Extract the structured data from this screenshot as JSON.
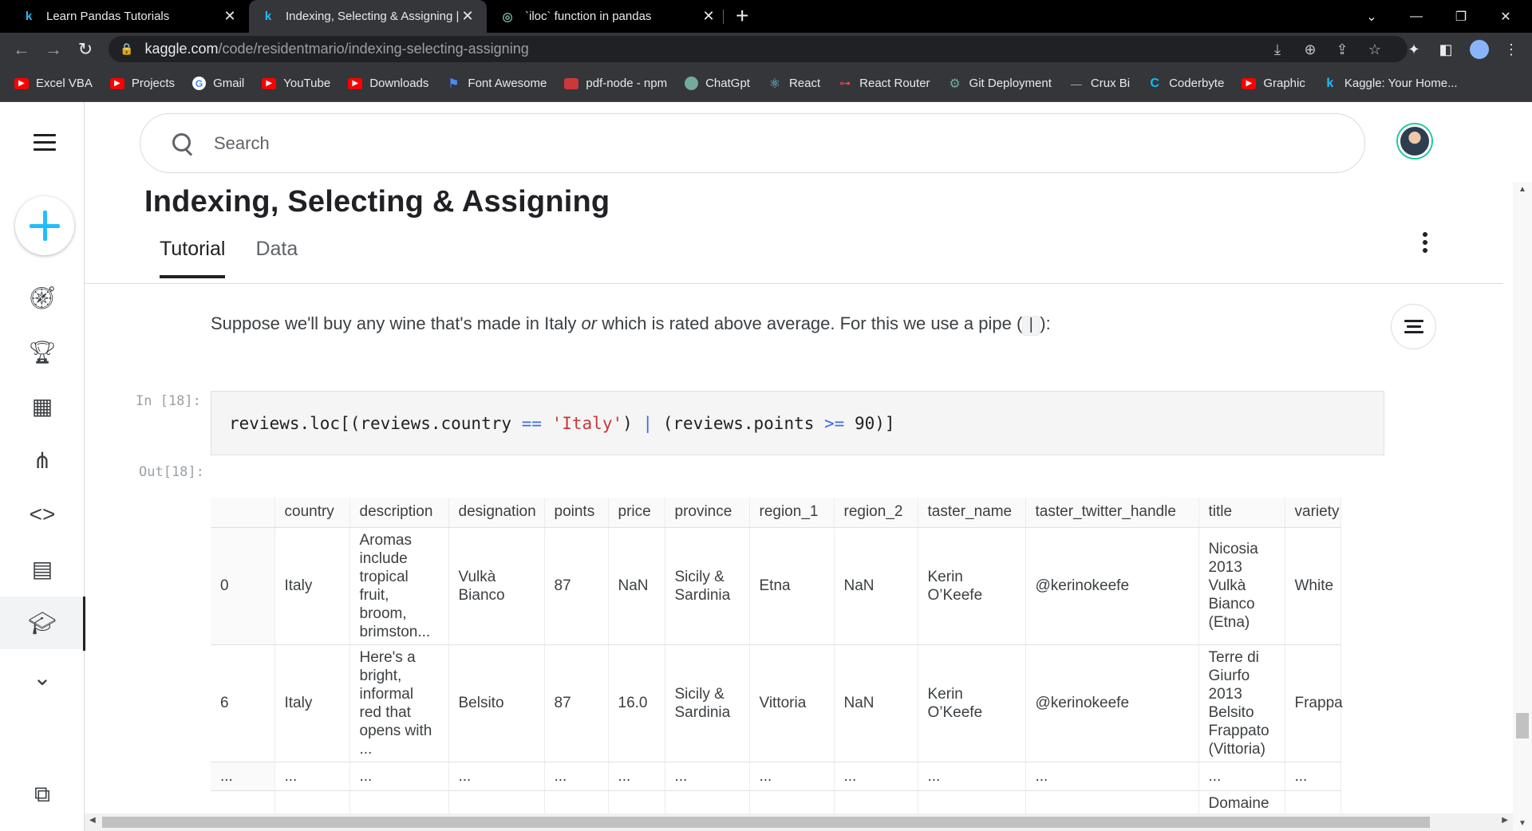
{
  "browser": {
    "tabs": [
      {
        "title": "Learn Pandas Tutorials",
        "favicon": "k"
      },
      {
        "title": "Indexing, Selecting & Assigning |",
        "favicon": "k"
      },
      {
        "title": "`iloc` function in pandas",
        "favicon": "chatgpt-logo"
      }
    ],
    "url_host": "kaggle.com",
    "url_path": "/code/residentmario/indexing-selecting-assigning",
    "bookmarks": [
      {
        "label": "Excel VBA",
        "icon": "youtube-icon"
      },
      {
        "label": "Projects",
        "icon": "youtube-icon"
      },
      {
        "label": "Gmail",
        "icon": "google-icon"
      },
      {
        "label": "YouTube",
        "icon": "youtube-icon"
      },
      {
        "label": "Downloads",
        "icon": "youtube-icon"
      },
      {
        "label": "Font Awesome",
        "icon": "flag-icon"
      },
      {
        "label": "pdf-node - npm",
        "icon": "npm-icon"
      },
      {
        "label": "ChatGpt",
        "icon": "chatgpt-icon"
      },
      {
        "label": "React",
        "icon": "react-icon"
      },
      {
        "label": "React Router",
        "icon": "react-router-icon"
      },
      {
        "label": "Git Deployment",
        "icon": "git-icon"
      },
      {
        "label": "Crux Bi",
        "icon": "crux-icon"
      },
      {
        "label": "Coderbyte",
        "icon": "coderbyte-icon"
      },
      {
        "label": "Graphic",
        "icon": "youtube-icon"
      },
      {
        "label": "Kaggle: Your Home...",
        "icon": "kaggle-icon"
      }
    ]
  },
  "search": {
    "placeholder": "Search"
  },
  "notebook": {
    "title": "Indexing, Selecting & Assigning",
    "tabs": [
      "Tutorial",
      "Data"
    ],
    "prose_before": "Suppose we'll buy any wine that's made in Italy ",
    "prose_em": "or",
    "prose_after": " which is rated above average. For this we use a pipe (",
    "prose_code": "|",
    "prose_end": "):",
    "in_prompt": "In [18]:",
    "out_prompt": "Out[18]:",
    "code": {
      "t1": "reviews.loc[(reviews.country ",
      "op1": "==",
      "t2": " ",
      "str1": "'Italy'",
      "t3": ") ",
      "op2": "|",
      "t4": " (reviews.points ",
      "op3": ">=",
      "t5": " ",
      "num1": "90",
      "t6": ")]"
    }
  },
  "table": {
    "columns": [
      "",
      "country",
      "description",
      "designation",
      "points",
      "price",
      "province",
      "region_1",
      "region_2",
      "taster_name",
      "taster_twitter_handle",
      "title",
      "variety"
    ],
    "rows": [
      [
        "0",
        "Italy",
        "Aromas include tropical fruit, broom, brimston...",
        "Vulkà Bianco",
        "87",
        "NaN",
        "Sicily & Sardinia",
        "Etna",
        "NaN",
        "Kerin O’Keefe",
        "@kerinokeefe",
        "Nicosia 2013 Vulkà Bianco (Etna)",
        "White"
      ],
      [
        "6",
        "Italy",
        "Here's a bright, informal red that opens with ...",
        "Belsito",
        "87",
        "16.0",
        "Sicily & Sardinia",
        "Vittoria",
        "NaN",
        "Kerin O’Keefe",
        "@kerinokeefe",
        "Terre di Giurfo 2013 Belsito Frappato (Vittoria)",
        "Frappa"
      ],
      [
        "...",
        "...",
        "...",
        "...",
        "...",
        "...",
        "...",
        "...",
        "...",
        "...",
        "...",
        "...",
        "..."
      ],
      [
        "",
        "",
        "",
        "",
        "",
        "",
        "",
        "",
        "",
        "",
        "",
        "Domaine",
        ""
      ]
    ]
  },
  "colors": {
    "accent": "#20beff",
    "code_operator": "#3b6ee7",
    "code_string": "#c8383b"
  }
}
